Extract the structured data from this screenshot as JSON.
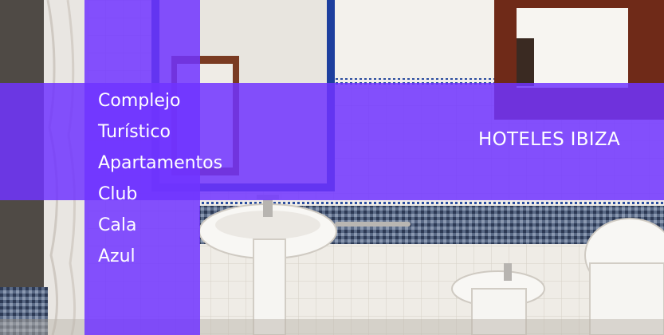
{
  "photo": {
    "subject": "bathroom-photo"
  },
  "overlay": {
    "band_color": "#7034ff",
    "title_lines": [
      "Complejo",
      "Turístico",
      "Apartamentos",
      "Club",
      "Cala",
      "Azul"
    ],
    "brand_label": "HOTELES IBIZA"
  }
}
